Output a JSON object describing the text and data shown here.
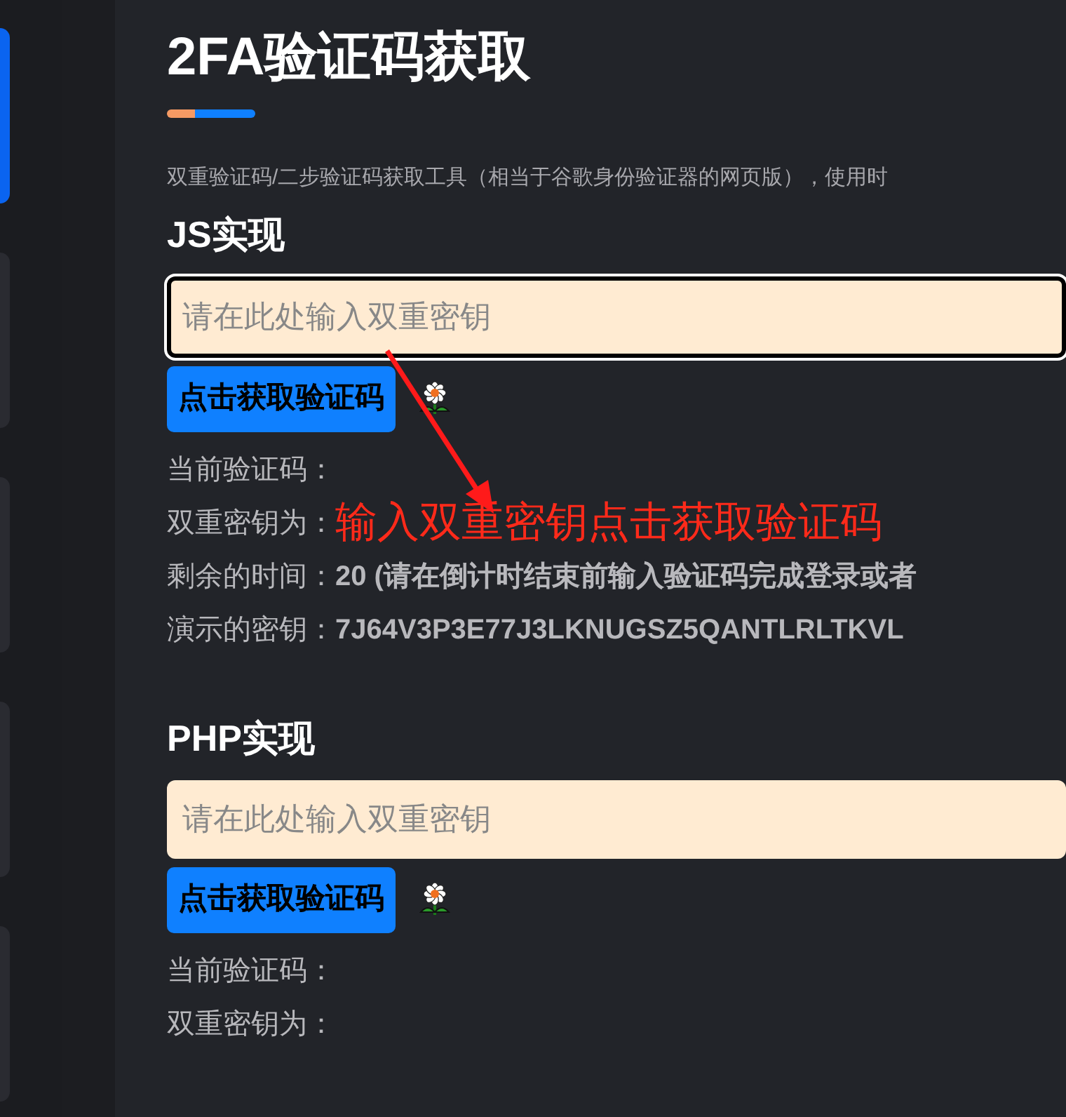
{
  "title": "2FA验证码获取",
  "description": "双重验证码/二步验证码获取工具（相当于谷歌身份验证器的网页版），使用时",
  "sidebar": {
    "cards": [
      {
        "selected": true
      },
      {
        "selected": false
      },
      {
        "selected": false
      },
      {
        "selected": false
      },
      {
        "selected": false
      }
    ]
  },
  "sections": [
    {
      "heading": "JS实现",
      "input": {
        "placeholder": "请在此处输入双重密钥",
        "focused": true
      },
      "button": "点击获取验证码",
      "rows": [
        {
          "label": "当前验证码："
        },
        {
          "label": "双重密钥为：",
          "annotation": "输入双重密钥点击获取验证码"
        },
        {
          "label": "剩余的时间：",
          "value": "20 (请在倒计时结束前输入验证码完成登录或者"
        },
        {
          "label": "演示的密钥：",
          "value": "7J64V3P3E77J3LKNUGSZ5QANTLRLTKVL"
        }
      ]
    },
    {
      "heading": "PHP实现",
      "input": {
        "placeholder": "请在此处输入双重密钥",
        "focused": false
      },
      "button": "点击获取验证码",
      "rows": [
        {
          "label": "当前验证码："
        },
        {
          "label": "双重密钥为："
        }
      ]
    }
  ]
}
